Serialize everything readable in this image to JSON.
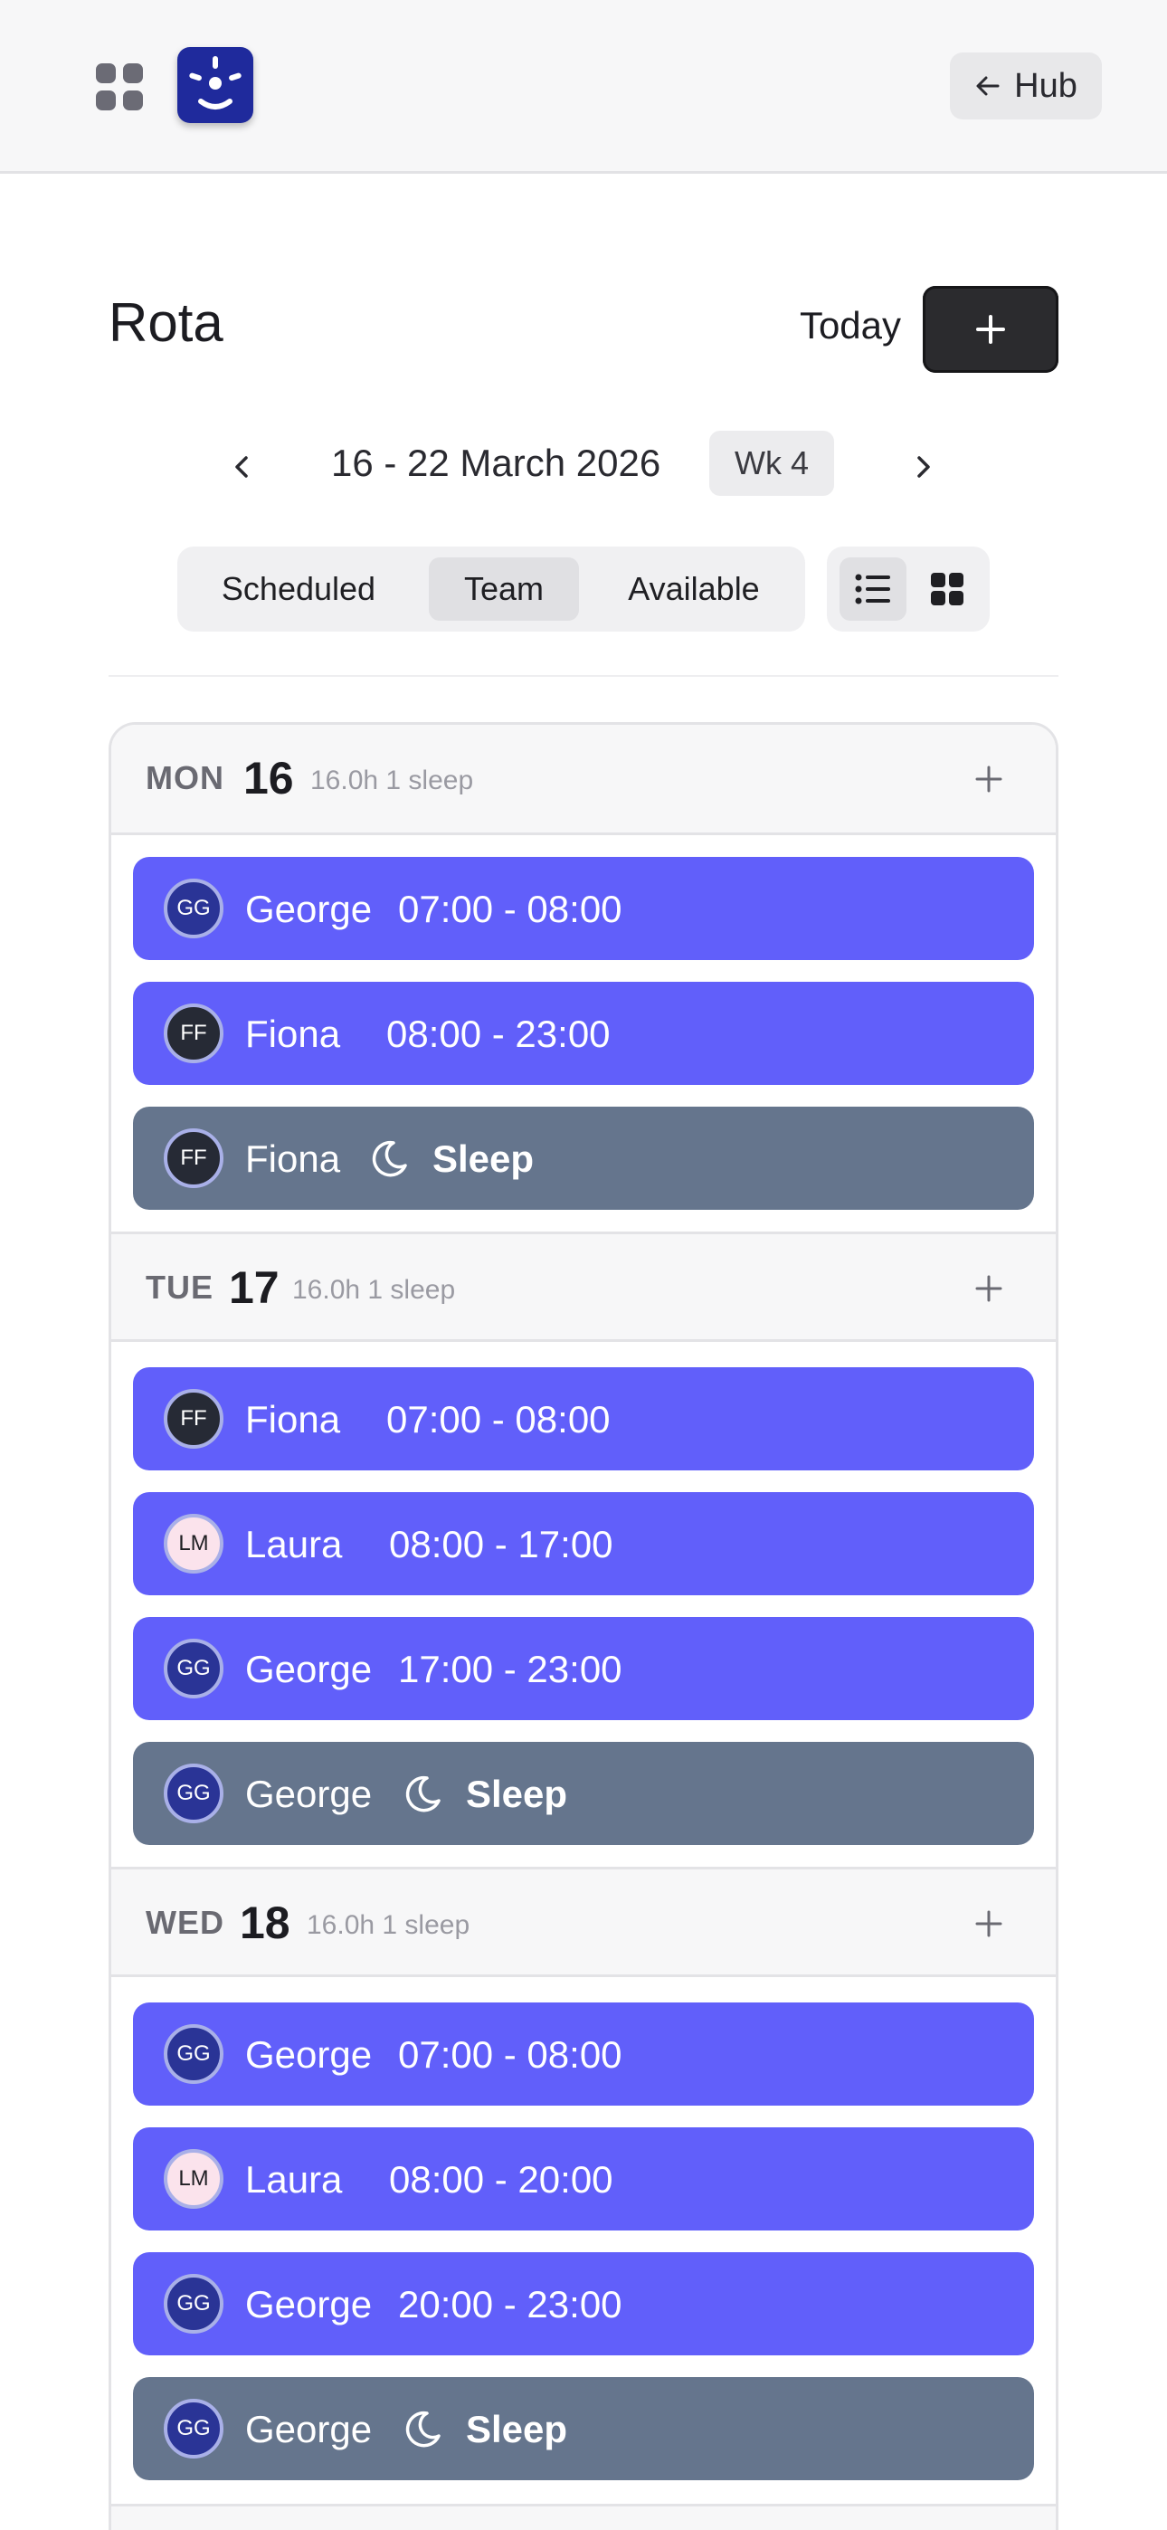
{
  "topbar": {
    "hub_label": "Hub"
  },
  "header": {
    "title": "Rota",
    "today_label": "Today",
    "add_label": "+"
  },
  "week": {
    "range": "16 - 22 March 2026",
    "badge": "Wk 4"
  },
  "segments": [
    {
      "label": "Scheduled",
      "active": false
    },
    {
      "label": "Team",
      "active": true
    },
    {
      "label": "Available",
      "active": false
    }
  ],
  "view_toggle": {
    "selected": "list"
  },
  "days": [
    {
      "name": "MON",
      "num": "16",
      "meta": "16.0h 1 sleep",
      "shifts": [
        {
          "initials": "GG",
          "name": "George",
          "time": "07:00 - 08:00",
          "type": "work"
        },
        {
          "initials": "FF",
          "name": "Fiona",
          "time": "08:00 - 23:00",
          "type": "work"
        },
        {
          "initials": "FF",
          "name": "Fiona",
          "sleep": "Sleep",
          "type": "sleep"
        }
      ]
    },
    {
      "name": "TUE",
      "num": "17",
      "meta": "16.0h 1 sleep",
      "shifts": [
        {
          "initials": "FF",
          "name": "Fiona",
          "time": "07:00 - 08:00",
          "type": "work"
        },
        {
          "initials": "LM",
          "name": "Laura",
          "time": "08:00 - 17:00",
          "type": "work"
        },
        {
          "initials": "GG",
          "name": "George",
          "time": "17:00 - 23:00",
          "type": "work"
        },
        {
          "initials": "GG",
          "name": "George",
          "sleep": "Sleep",
          "type": "sleep"
        }
      ]
    },
    {
      "name": "WED",
      "num": "18",
      "meta": "16.0h 1 sleep",
      "shifts": [
        {
          "initials": "GG",
          "name": "George",
          "time": "07:00 - 08:00",
          "type": "work"
        },
        {
          "initials": "LM",
          "name": "Laura",
          "time": "08:00 - 20:00",
          "type": "work"
        },
        {
          "initials": "GG",
          "name": "George",
          "time": "20:00 - 23:00",
          "type": "work"
        },
        {
          "initials": "GG",
          "name": "George",
          "sleep": "Sleep",
          "type": "sleep"
        }
      ]
    }
  ]
}
